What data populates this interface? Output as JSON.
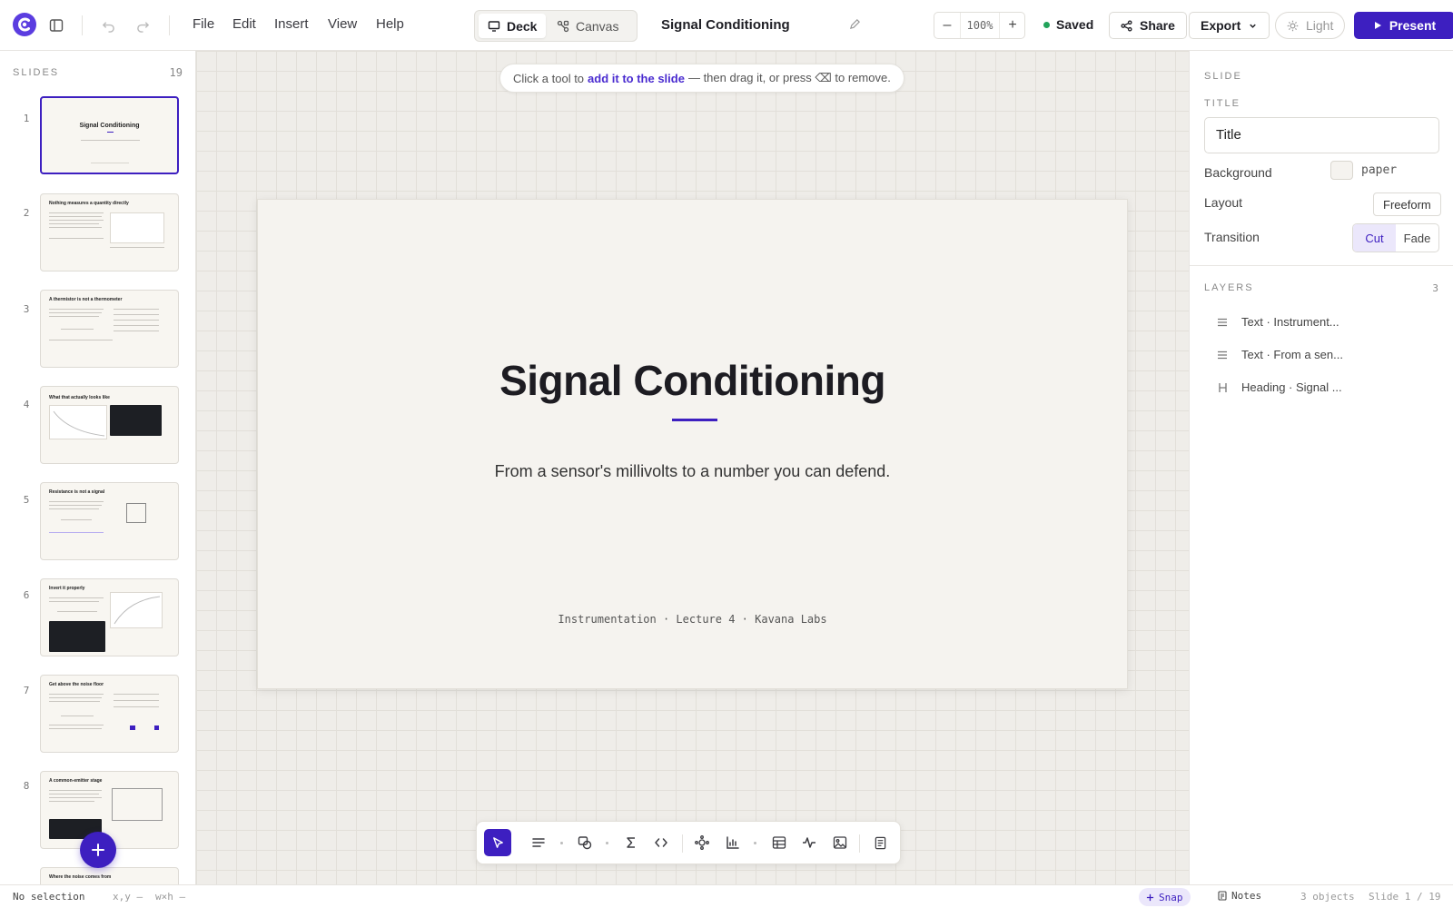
{
  "topbar": {
    "menus": [
      "File",
      "Edit",
      "Insert",
      "View",
      "Help"
    ],
    "view_tabs": [
      "Deck",
      "Canvas"
    ],
    "active_view": "Deck",
    "doc_title": "Signal Conditioning",
    "zoom": "100%",
    "zoom_out": "–",
    "zoom_in": "+",
    "save_status": "Saved",
    "share": "Share",
    "export": "Export",
    "theme": "Light",
    "present": "Present"
  },
  "sidebar": {
    "heading": "SLIDES",
    "count": "19",
    "slides": [
      {
        "num": "1",
        "title": "Signal Conditioning"
      },
      {
        "num": "2",
        "title": "Nothing measures a quantity directly"
      },
      {
        "num": "3",
        "title": "A thermistor is not a thermometer"
      },
      {
        "num": "4",
        "title": "What that actually looks like"
      },
      {
        "num": "5",
        "title": "Resistance is not a signal"
      },
      {
        "num": "6",
        "title": "Invert it properly"
      },
      {
        "num": "7",
        "title": "Get above the noise floor"
      },
      {
        "num": "8",
        "title": "A common-emitter stage"
      },
      {
        "num": "9",
        "title": "Where the noise comes from"
      }
    ]
  },
  "canvas": {
    "hint_pre": "Click a tool to",
    "hint_link": "add it to the slide",
    "hint_post": "— then drag it, or press ⌫ to remove.",
    "slide": {
      "title": "Signal Conditioning",
      "subtitle": "From a sensor's millivolts to a number you can defend.",
      "footer": "Instrumentation · Lecture 4 · Kavana Labs"
    }
  },
  "inspector": {
    "section": "SLIDE",
    "title_label": "TITLE",
    "title_value": "Title",
    "background_label": "Background",
    "background_value": "paper",
    "layout_label": "Layout",
    "layout_value": "Freeform",
    "transition_label": "Transition",
    "transition_options": [
      "Cut",
      "Fade"
    ],
    "transition_selected": "Cut",
    "layers_label": "LAYERS",
    "layers_count": "3",
    "layers": [
      {
        "kind": "text",
        "label": "Text · Instrument..."
      },
      {
        "kind": "text",
        "label": "Text · From a sen..."
      },
      {
        "kind": "heading",
        "label": "Heading · Signal ..."
      }
    ]
  },
  "status": {
    "selection": "No selection",
    "xy": "x,y —",
    "wh": "w×h —",
    "snap": "Snap",
    "notes": "Notes",
    "objects": "3 objects",
    "slide_pos": "Slide 1 / 19"
  },
  "colors": {
    "accent": "#3d1fc0",
    "saved_dot": "#22a35a",
    "slide_paper": "#f5f3ef"
  }
}
